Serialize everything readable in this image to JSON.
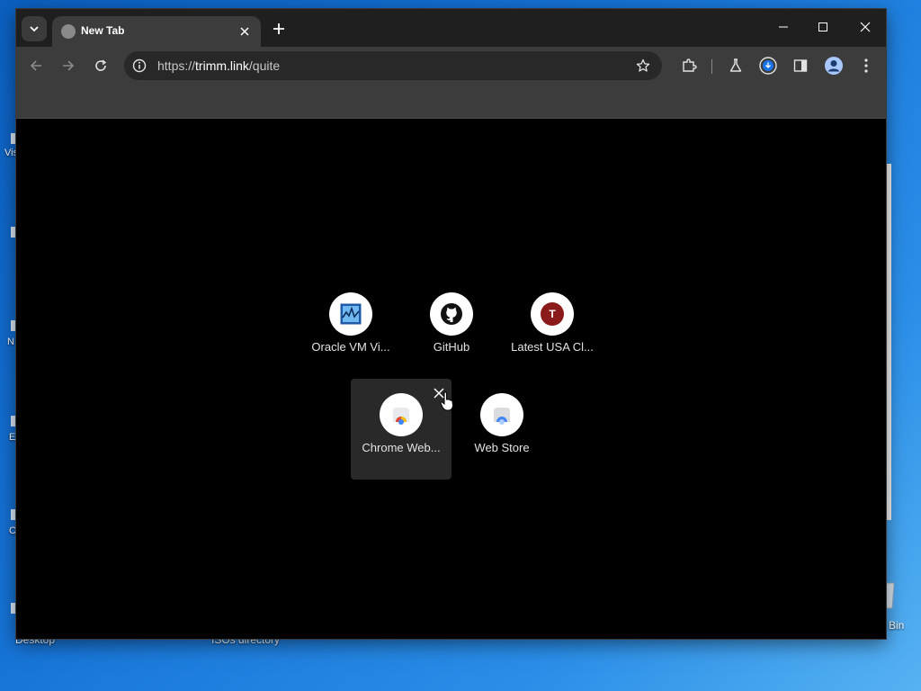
{
  "desktop": {
    "icons": [
      {
        "label": "Desktop"
      },
      {
        "label": "ISOs directory"
      },
      {
        "label": "Bin"
      }
    ],
    "edge_fragments": [
      "Vis",
      "N",
      "E",
      "C"
    ]
  },
  "browser": {
    "tab": {
      "title": "New Tab",
      "favicon": "globe-icon"
    },
    "url": {
      "scheme": "https://",
      "host": "trimm.link",
      "path": "/quite"
    },
    "colors": {
      "frame": "#1f1f1f",
      "toolbar": "#3c3c3c",
      "omnibox": "#282828",
      "page": "#000000"
    }
  },
  "shortcuts": [
    {
      "label": "Oracle VM Vi...",
      "icon": "virtualbox-icon"
    },
    {
      "label": "GitHub",
      "icon": "github-icon"
    },
    {
      "label": "Latest USA Cl...",
      "icon": "letter-avatar",
      "letter": "T",
      "color": "#8b1a1a"
    },
    {
      "label": "Chrome Web...",
      "icon": "chrome-web-store-icon",
      "hovered": true
    },
    {
      "label": "Web Store",
      "icon": "web-store-icon"
    }
  ]
}
